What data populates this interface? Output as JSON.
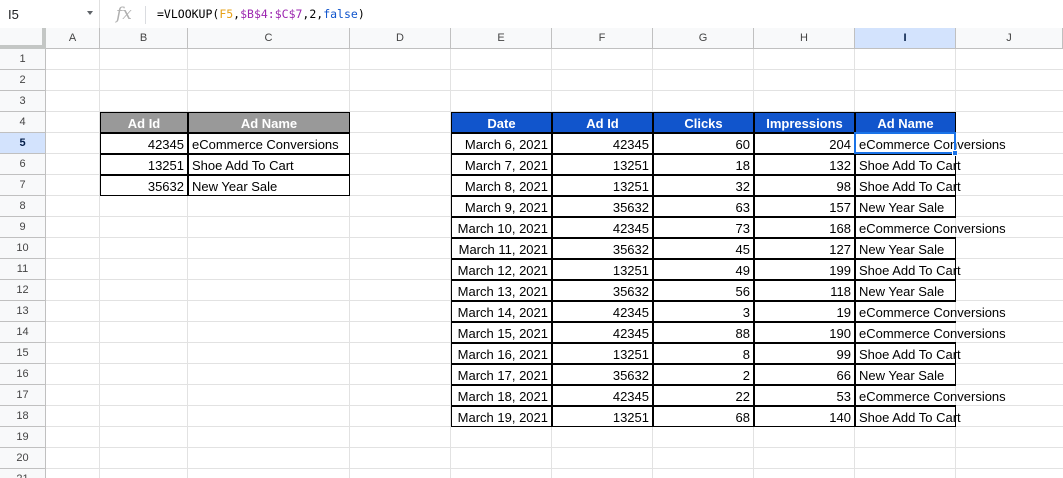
{
  "formula_bar": {
    "name_box": "I5",
    "formula_prefix": "=VLOOKUP(",
    "ref1": "F5",
    "comma1": ",",
    "ref2": "$B$4:$C$7",
    "middle": ",2,",
    "keyword": "false",
    "suffix": ")"
  },
  "columns": [
    "A",
    "B",
    "C",
    "D",
    "E",
    "F",
    "G",
    "H",
    "I",
    "J"
  ],
  "rows": [
    "1",
    "2",
    "3",
    "4",
    "5",
    "6",
    "7",
    "8",
    "9",
    "10",
    "11",
    "12",
    "13",
    "14",
    "15",
    "16",
    "17",
    "18",
    "19",
    "20",
    "21"
  ],
  "lookup_table": {
    "headers": [
      "Ad Id",
      "Ad Name"
    ],
    "rows": [
      [
        "42345",
        "eCommerce Conversions"
      ],
      [
        "13251",
        "Shoe Add To Cart"
      ],
      [
        "35632",
        "New Year Sale"
      ]
    ]
  },
  "data_table": {
    "headers": [
      "Date",
      "Ad Id",
      "Clicks",
      "Impressions",
      "Ad Name"
    ],
    "rows": [
      [
        "March 6, 2021",
        "42345",
        "60",
        "204",
        "eCommerce Conversions"
      ],
      [
        "March 7, 2021",
        "13251",
        "18",
        "132",
        "Shoe Add To Cart"
      ],
      [
        "March 8, 2021",
        "13251",
        "32",
        "98",
        "Shoe Add To Cart"
      ],
      [
        "March 9, 2021",
        "35632",
        "63",
        "157",
        "New Year Sale"
      ],
      [
        "March 10, 2021",
        "42345",
        "73",
        "168",
        "eCommerce Conversions"
      ],
      [
        "March 11, 2021",
        "35632",
        "45",
        "127",
        "New Year Sale"
      ],
      [
        "March 12, 2021",
        "13251",
        "49",
        "199",
        "Shoe Add To Cart"
      ],
      [
        "March 13, 2021",
        "35632",
        "56",
        "118",
        "New Year Sale"
      ],
      [
        "March 14, 2021",
        "42345",
        "3",
        "19",
        "eCommerce Conversions"
      ],
      [
        "March 15, 2021",
        "42345",
        "88",
        "190",
        "eCommerce Conversions"
      ],
      [
        "March 16, 2021",
        "13251",
        "8",
        "99",
        "Shoe Add To Cart"
      ],
      [
        "March 17, 2021",
        "35632",
        "2",
        "66",
        "New Year Sale"
      ],
      [
        "March 18, 2021",
        "42345",
        "22",
        "53",
        "eCommerce Conversions"
      ],
      [
        "March 19, 2021",
        "13251",
        "68",
        "140",
        "Shoe Add To Cart"
      ]
    ]
  },
  "colors": {
    "header_gray": "#999999",
    "header_blue": "#1155cc",
    "selection": "#1a73e8"
  }
}
